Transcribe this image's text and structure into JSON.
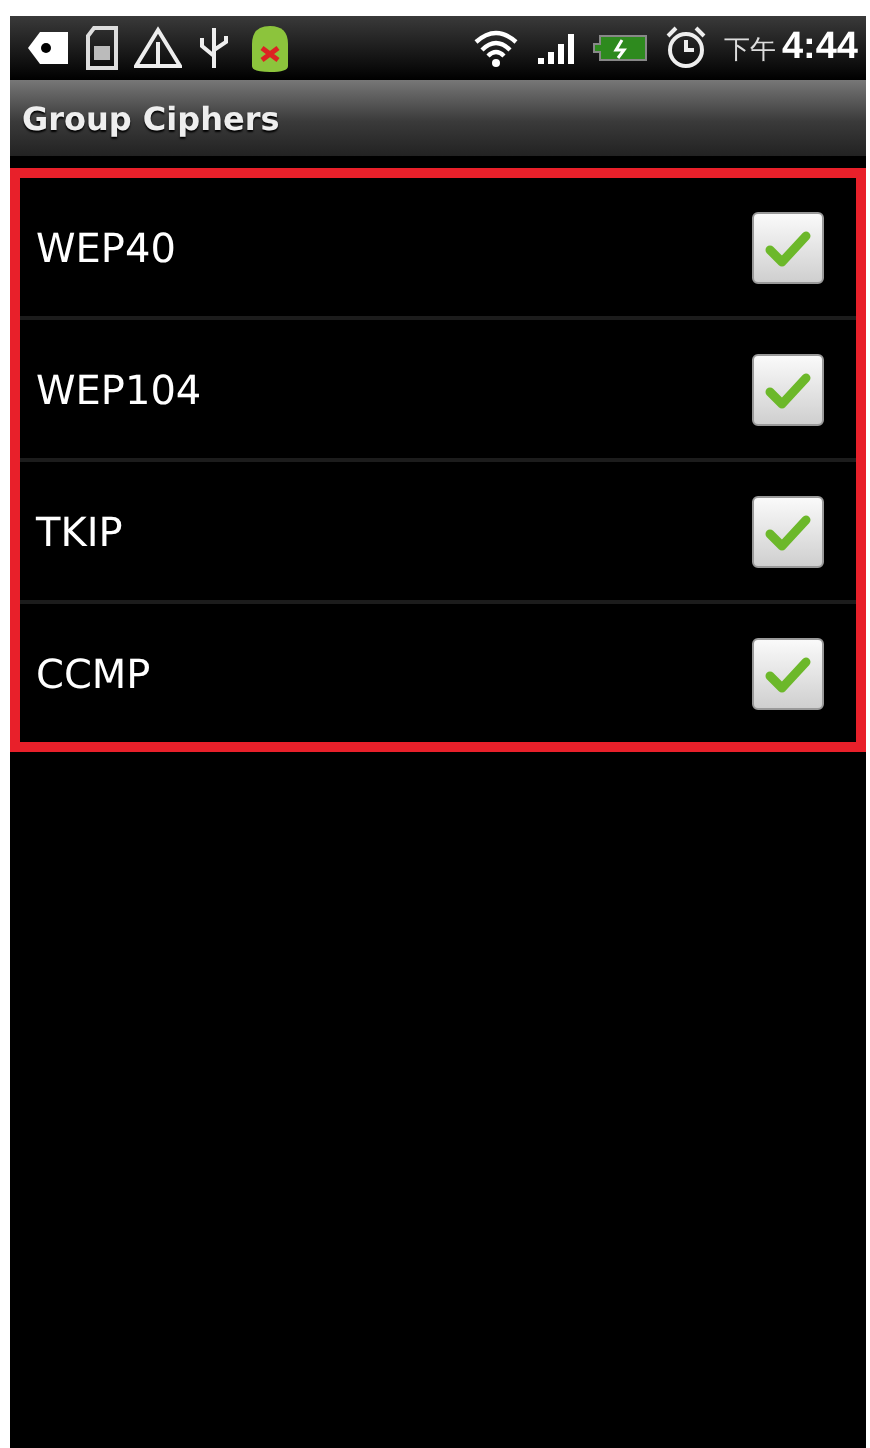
{
  "status_bar": {
    "time_period": "下午",
    "time": "4:44"
  },
  "title_bar": {
    "title": "Group Ciphers"
  },
  "ciphers": [
    {
      "label": "WEP40",
      "checked": true
    },
    {
      "label": "WEP104",
      "checked": true
    },
    {
      "label": "TKIP",
      "checked": true
    },
    {
      "label": "CCMP",
      "checked": true
    }
  ]
}
